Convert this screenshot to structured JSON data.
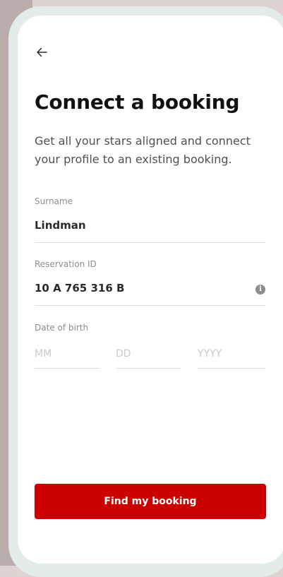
{
  "header": {
    "back_icon": "arrow-left-icon"
  },
  "page": {
    "title": "Connect a booking",
    "description": "Get all your stars aligned and connect your profile to an existing booking."
  },
  "form": {
    "surname": {
      "label": "Surname",
      "value": "Lindman"
    },
    "reservation_id": {
      "label": "Reservation ID",
      "value": "10 A 765 316 B",
      "icon": "info-icon"
    },
    "date_of_birth": {
      "label": "Date of birth",
      "month_placeholder": "MM",
      "day_placeholder": "DD",
      "year_placeholder": "YYYY"
    }
  },
  "actions": {
    "primary_label": "Find my booking"
  },
  "colors": {
    "primary": "#cc0000",
    "background": "#ddd3d3",
    "frame": "#e3ecea",
    "screen": "#ffffff"
  }
}
